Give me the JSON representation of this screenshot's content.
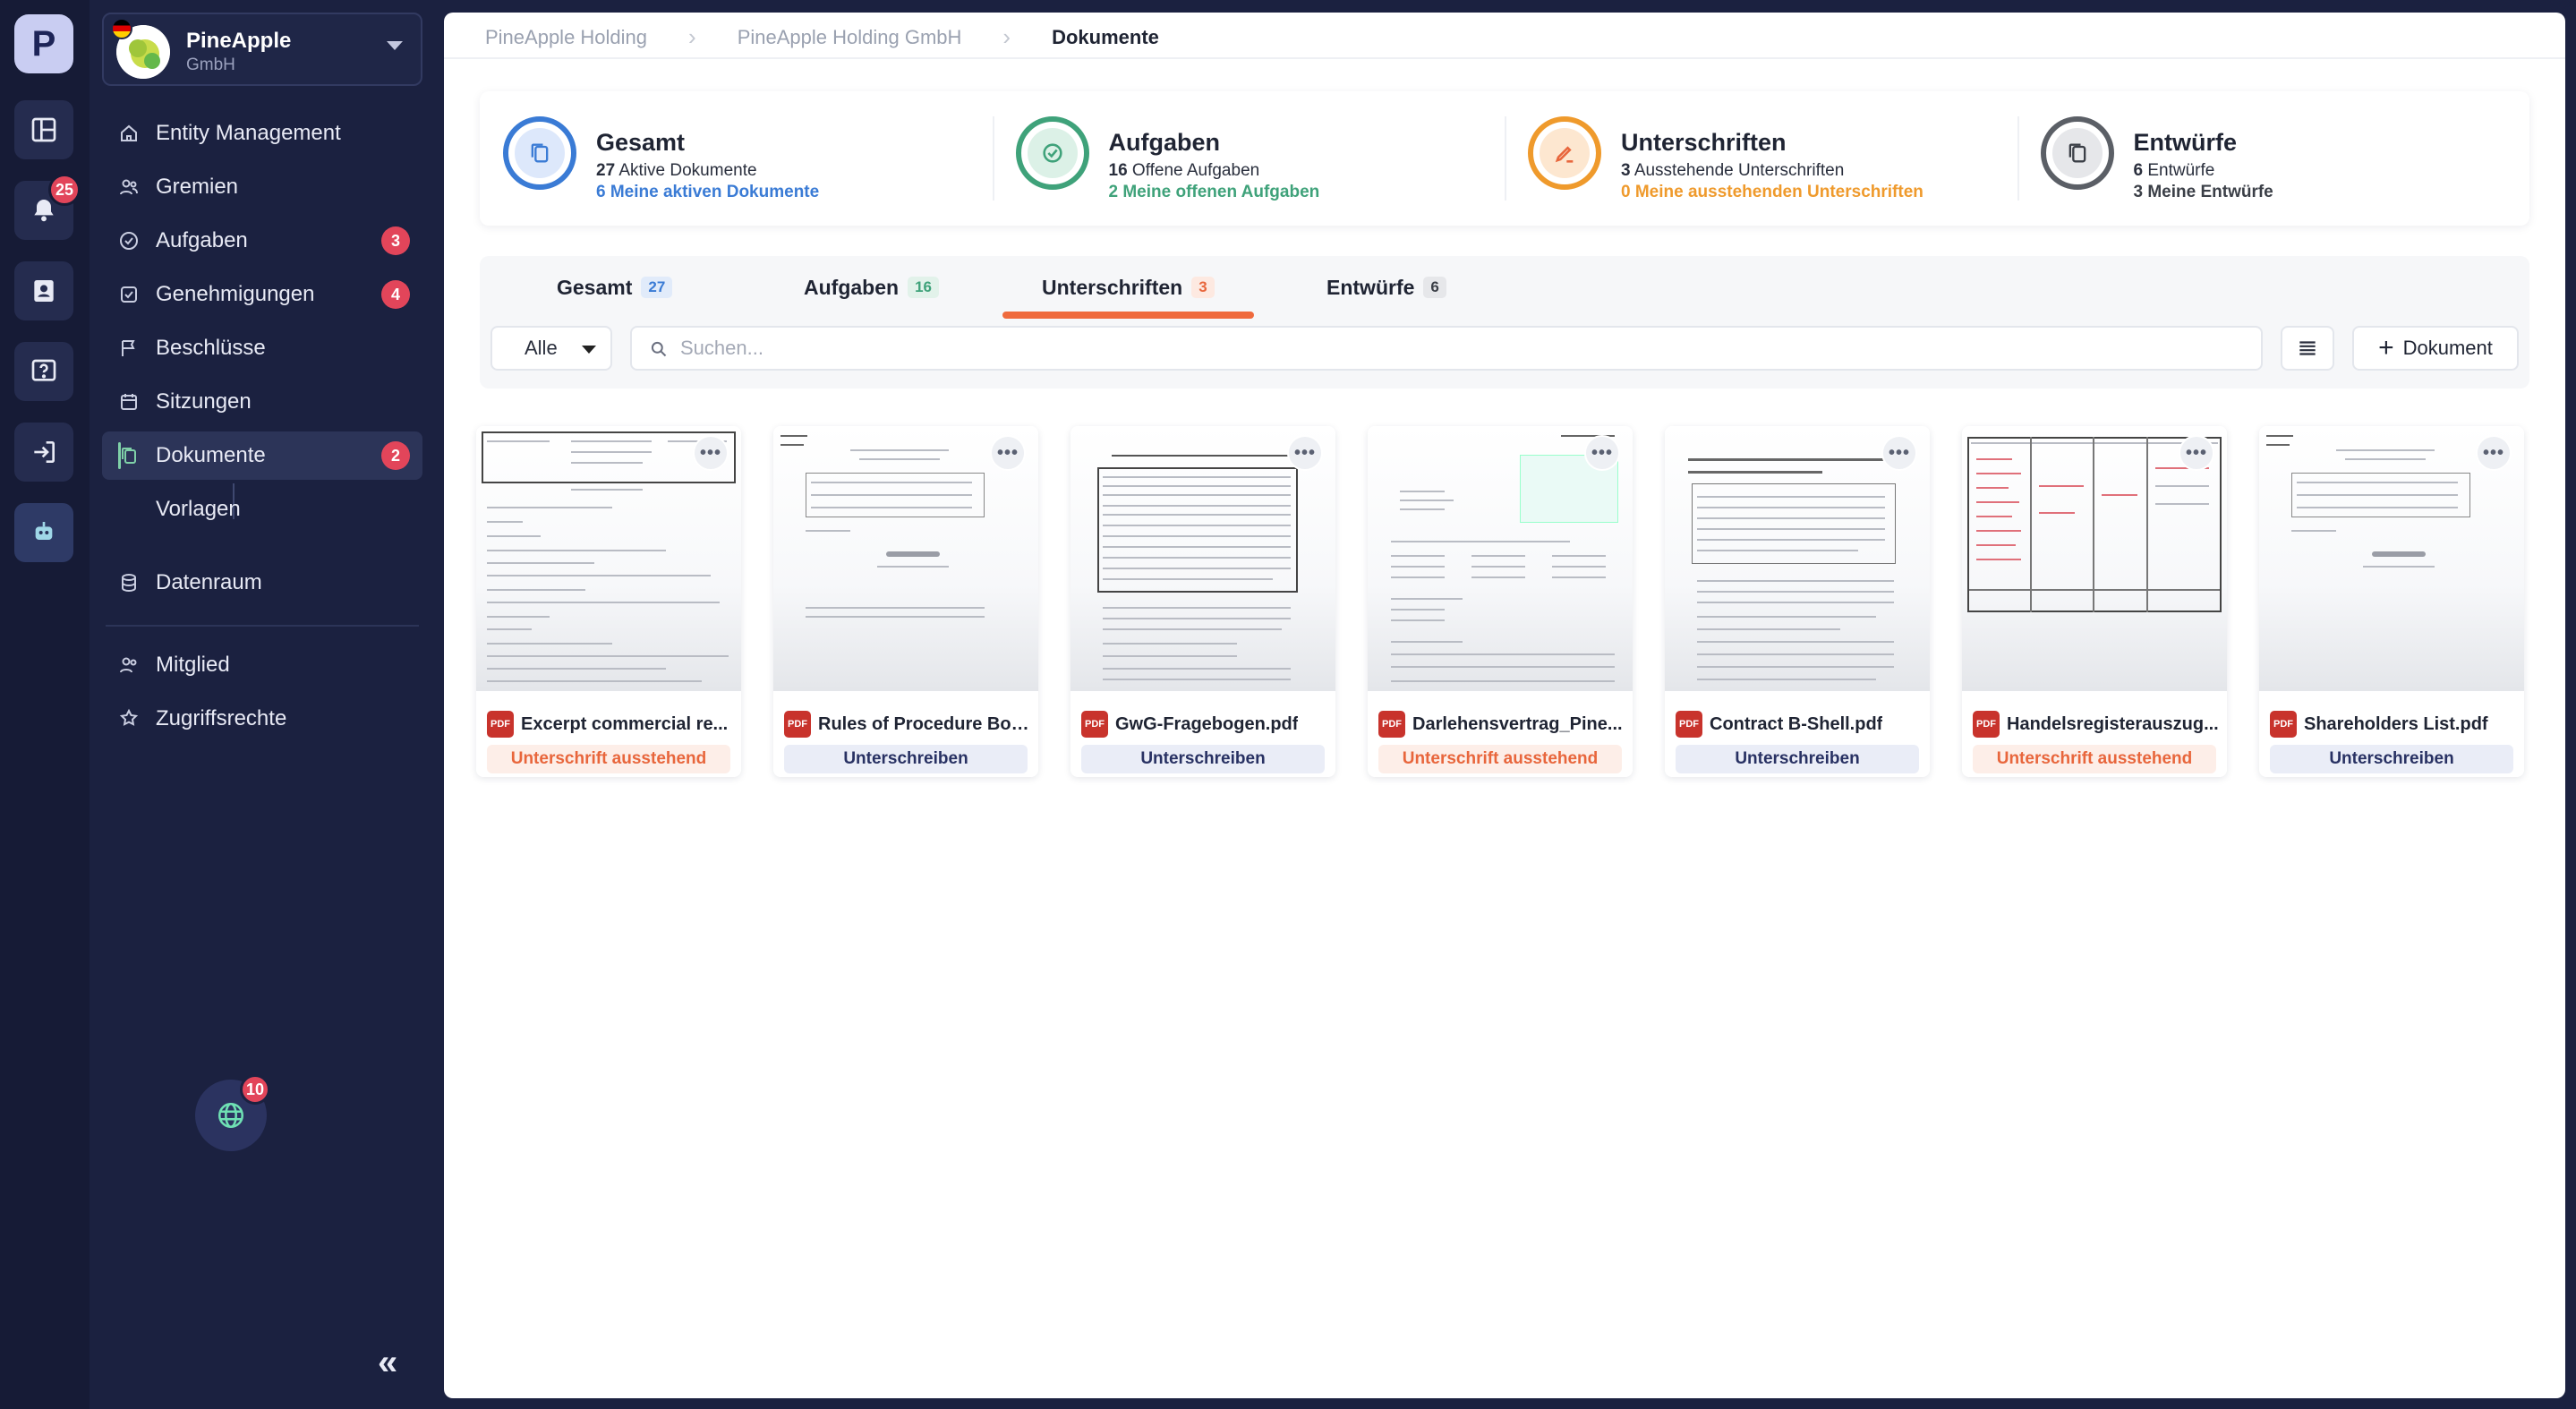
{
  "rail": {
    "logo": "P",
    "notifications_badge": "25"
  },
  "org": {
    "name": "PineApple",
    "sub": "GmbH"
  },
  "nav": {
    "entity": "Entity Management",
    "gremien": "Gremien",
    "aufgaben": "Aufgaben",
    "aufgaben_badge": "3",
    "genehmigungen": "Genehmigungen",
    "genehmigungen_badge": "4",
    "beschluesse": "Beschlüsse",
    "sitzungen": "Sitzungen",
    "dokumente": "Dokumente",
    "dokumente_badge": "2",
    "vorlagen": "Vorlagen",
    "datenraum": "Datenraum",
    "mitglied": "Mitglied",
    "zugriffsrechte": "Zugriffsrechte",
    "globe_badge": "10",
    "collapse": "«"
  },
  "breadcrumb": [
    "PineApple Holding",
    "PineApple Holding GmbH",
    "Dokumente"
  ],
  "stats": [
    {
      "title": "Gesamt",
      "count": "27",
      "label": "Aktive Dokumente",
      "sub": "6 Meine aktiven Dokumente",
      "color": "#3a7bd5"
    },
    {
      "title": "Aufgaben",
      "count": "16",
      "label": "Offene Aufgaben",
      "sub": "2 Meine offenen Aufgaben",
      "color": "#3fa27a"
    },
    {
      "title": "Unterschriften",
      "count": "3",
      "label": "Ausstehende Unterschriften",
      "sub": "0 Meine ausstehenden Unterschriften",
      "color": "#ef9a2c"
    },
    {
      "title": "Entwürfe",
      "count": "6",
      "label": "Entwürfe",
      "sub": "3 Meine Entwürfe",
      "color": "#5b5f66"
    }
  ],
  "tabs": [
    {
      "label": "Gesamt",
      "count": "27"
    },
    {
      "label": "Aufgaben",
      "count": "16"
    },
    {
      "label": "Unterschriften",
      "count": "3"
    },
    {
      "label": "Entwürfe",
      "count": "6"
    }
  ],
  "filter": {
    "selected": "Alle"
  },
  "search": {
    "placeholder": "Suchen..."
  },
  "add_document": "Dokument",
  "file_type": "PDF",
  "more_glyph": "•••",
  "documents": [
    {
      "name": "Excerpt commercial re...",
      "action": "Unterschrift ausstehend",
      "status": "pending"
    },
    {
      "name": "Rules of Procedure Boa...",
      "action": "Unterschreiben",
      "status": "sign"
    },
    {
      "name": "GwG-Fragebogen.pdf",
      "action": "Unterschreiben",
      "status": "sign"
    },
    {
      "name": "Darlehensvertrag_Pine...",
      "action": "Unterschrift ausstehend",
      "status": "pending"
    },
    {
      "name": "Contract B-Shell.pdf",
      "action": "Unterschreiben",
      "status": "sign"
    },
    {
      "name": "Handelsregisterauszug...",
      "action": "Unterschrift ausstehend",
      "status": "pending"
    },
    {
      "name": "Shareholders List.pdf",
      "action": "Unterschreiben",
      "status": "sign"
    }
  ]
}
